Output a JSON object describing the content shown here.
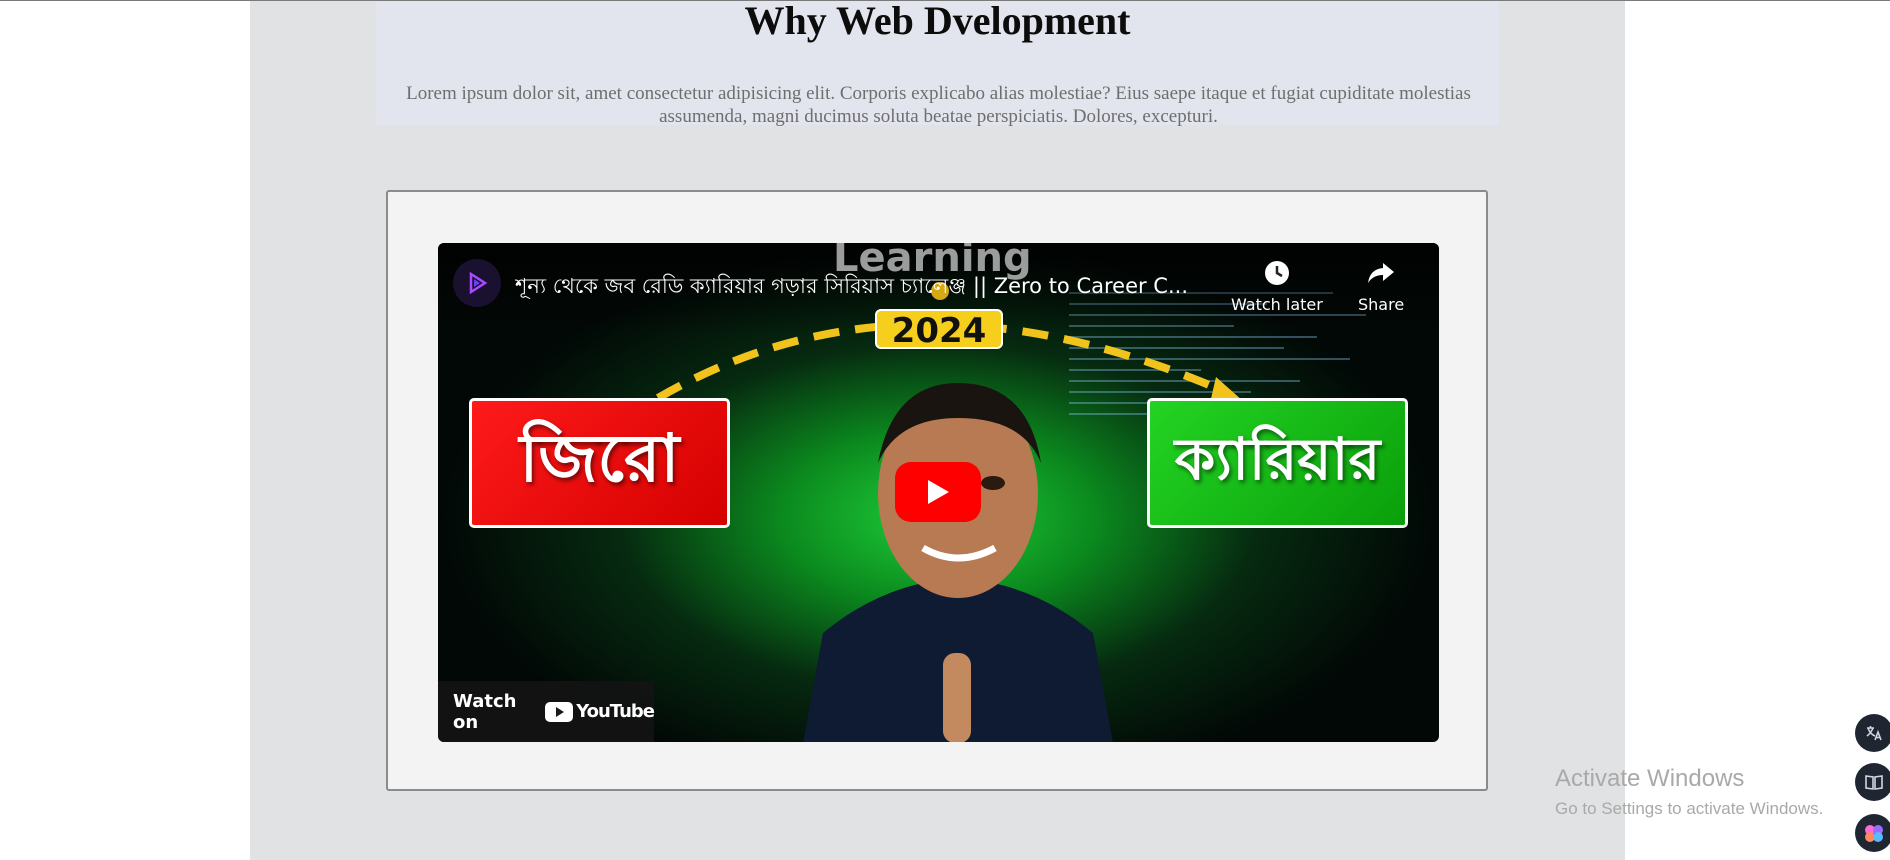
{
  "page": {
    "title": "Why Web Dvelopment",
    "description": "Lorem ipsum dolor sit, amet consectetur adipisicing elit. Corporis explicabo alias molestiae? Eius saepe itaque et fugiat cupiditate molestias assumenda, magni ducimus soluta beatae perspiciatis. Dolores, excepturi."
  },
  "video": {
    "title": "শূন্য থেকে জব রেডি ক্যারিয়ার গড়ার সিরিয়াস চ্যালেঞ্জ || Zero to Career C...",
    "watermark": "Learning",
    "watch_later_label": "Watch later",
    "share_label": "Share",
    "thumbnail_year": "2024",
    "thumbnail_left_text": "জিরো",
    "thumbnail_right_text": "ক্যারিয়ার",
    "watch_on_label": "Watch on",
    "youtube_logo_text": "YouTube"
  },
  "windows_watermark": {
    "line1": "Activate Windows",
    "line2": "Go to Settings to activate Windows."
  },
  "colors": {
    "youtube_red": "#ff0000",
    "column_bg": "#e0e2e3",
    "year_badge": "#f5cf1c"
  }
}
